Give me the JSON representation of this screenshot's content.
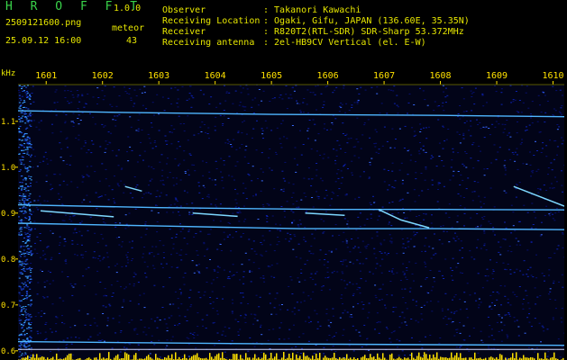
{
  "app": {
    "name": "H R O F F T",
    "version": "1.0.0"
  },
  "file": {
    "name": "2509121600.png",
    "datetime": "25.09.12 16:00"
  },
  "counter": {
    "label": "meteor",
    "value": "43"
  },
  "info": [
    {
      "label": "Observer",
      "value": ": Takanori Kawachi"
    },
    {
      "label": "Receiving Location",
      "value": ": Ogaki, Gifu, JAPAN (136.60E, 35.35N)"
    },
    {
      "label": "Receiver",
      "value": ": R820T2(RTL-SDR) SDR-Sharp 53.372MHz"
    },
    {
      "label": "Receiving antenna",
      "value": ": 2el-HB9CV Vertical (el. E-W)"
    }
  ],
  "chart_data": {
    "type": "heatmap",
    "ylabel": "kHz",
    "x_ticks": [
      "1601",
      "1602",
      "1603",
      "1604",
      "1605",
      "1606",
      "1607",
      "1608",
      "1609",
      "1610"
    ],
    "y_ticks": [
      "1.1",
      "1.0",
      "0.9",
      "0.8",
      "0.7",
      "0.6"
    ],
    "ylim": [
      0.58,
      1.18
    ],
    "xlim": [
      1600.5,
      1610.2
    ],
    "traces": [
      {
        "kind": "carrier",
        "points": [
          [
            1600.5,
            1.123
          ],
          [
            1602,
            1.12
          ],
          [
            1605,
            1.115
          ],
          [
            1608,
            1.113
          ],
          [
            1610.2,
            1.11
          ]
        ]
      },
      {
        "kind": "carrier",
        "points": [
          [
            1600.5,
            0.878
          ],
          [
            1603,
            0.872
          ],
          [
            1605.5,
            0.866
          ],
          [
            1608,
            0.866
          ],
          [
            1610.2,
            0.864
          ]
        ]
      },
      {
        "kind": "carrier",
        "points": [
          [
            1600.5,
            0.918
          ],
          [
            1603,
            0.912
          ],
          [
            1606,
            0.908
          ],
          [
            1608,
            0.908
          ],
          [
            1610.2,
            0.907
          ]
        ]
      },
      {
        "kind": "carrier",
        "points": [
          [
            1600.5,
            0.62
          ],
          [
            1605,
            0.615
          ],
          [
            1610.2,
            0.612
          ]
        ]
      },
      {
        "kind": "meteor",
        "points": [
          [
            1606.9,
            0.908
          ],
          [
            1607.3,
            0.885
          ],
          [
            1607.8,
            0.868
          ]
        ]
      },
      {
        "kind": "meteor",
        "points": [
          [
            1609.3,
            0.958
          ],
          [
            1610.2,
            0.915
          ]
        ]
      },
      {
        "kind": "meteor",
        "points": [
          [
            1602.4,
            0.958
          ],
          [
            1602.7,
            0.948
          ]
        ]
      },
      {
        "kind": "meteor",
        "points": [
          [
            1600.9,
            0.905
          ],
          [
            1602.2,
            0.892
          ]
        ]
      },
      {
        "kind": "meteor",
        "points": [
          [
            1603.6,
            0.9
          ],
          [
            1604.4,
            0.893
          ]
        ]
      },
      {
        "kind": "meteor",
        "points": [
          [
            1605.6,
            0.9
          ],
          [
            1606.3,
            0.895
          ]
        ]
      }
    ],
    "colors": {
      "trace": "#4fb6ff",
      "noise": "#0a1aa8",
      "bar": "#ffe100",
      "grid": "#ffffff"
    }
  }
}
